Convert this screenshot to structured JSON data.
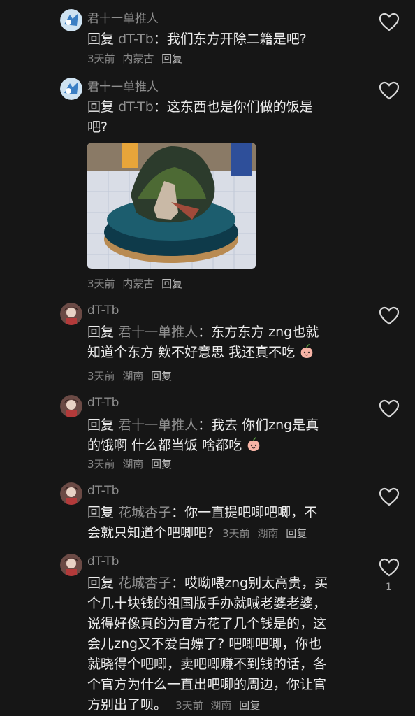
{
  "comments": [
    {
      "user": "君十一单推人",
      "reply_word": "回复",
      "target": "dT-Tb",
      "sep": "：",
      "text": "我们东方开除二籍是吧?",
      "time": "3天前",
      "location": "内蒙古",
      "reply_label": "回复"
    },
    {
      "user": "君十一单推人",
      "reply_word": "回复",
      "target": "dT-Tb",
      "sep": "：",
      "text_line1": "这东西也是你们做的饭是",
      "text_line2": "吧?",
      "image_icon": "figure-photo",
      "time": "3天前",
      "location": "内蒙古",
      "reply_label": "回复"
    },
    {
      "user": "dT-Tb",
      "reply_word": "回复",
      "target": "君十一单推人",
      "sep": "：",
      "text_line1": "东方东方 zng也就",
      "text_line2": "知道个东方 欸不好意思 我还真不吃",
      "emoji_icon": "peach-face-icon",
      "time": "3天前",
      "location": "湖南",
      "reply_label": "回复"
    },
    {
      "user": "dT-Tb",
      "reply_word": "回复",
      "target": "君十一单推人",
      "sep": "：",
      "text_line1": "我去 你们zng是真",
      "text_line2": "的饿啊 什么都当饭 啥都吃",
      "emoji_icon": "peach-face-icon",
      "time": "3天前",
      "location": "湖南",
      "reply_label": "回复"
    },
    {
      "user": "dT-Tb",
      "reply_word": "回复",
      "target": "花城杏子",
      "sep": "：",
      "text_line1": "你一直提吧唧吧唧，不",
      "text_line2": "会就只知道个吧唧吧?",
      "time": "3天前",
      "location": "湖南",
      "reply_label": "回复"
    },
    {
      "user": "dT-Tb",
      "reply_word": "回复",
      "target": "花城杏子",
      "sep": "：",
      "text_line1": "哎呦喂zng别太高贵，买",
      "text_line2": "个几十块钱的祖国版手办就喊老婆老婆，",
      "text_line3": "说得好像真的为官方花了几个钱是的，这",
      "text_line4": "会儿zng又不爱白嫖了? 吧唧吧唧，你也",
      "text_line5": "就晓得个吧唧，卖吧唧赚不到钱的话，各",
      "text_line6": "个官方为什么一直出吧唧的周边，你让官",
      "text_line7": "方别出了呗。",
      "time": "3天前",
      "location": "湖南",
      "reply_label": "回复",
      "likes": "1"
    }
  ],
  "colors": {
    "background": "#161616",
    "text_primary": "#ececec",
    "text_secondary": "#8e8e8e"
  }
}
